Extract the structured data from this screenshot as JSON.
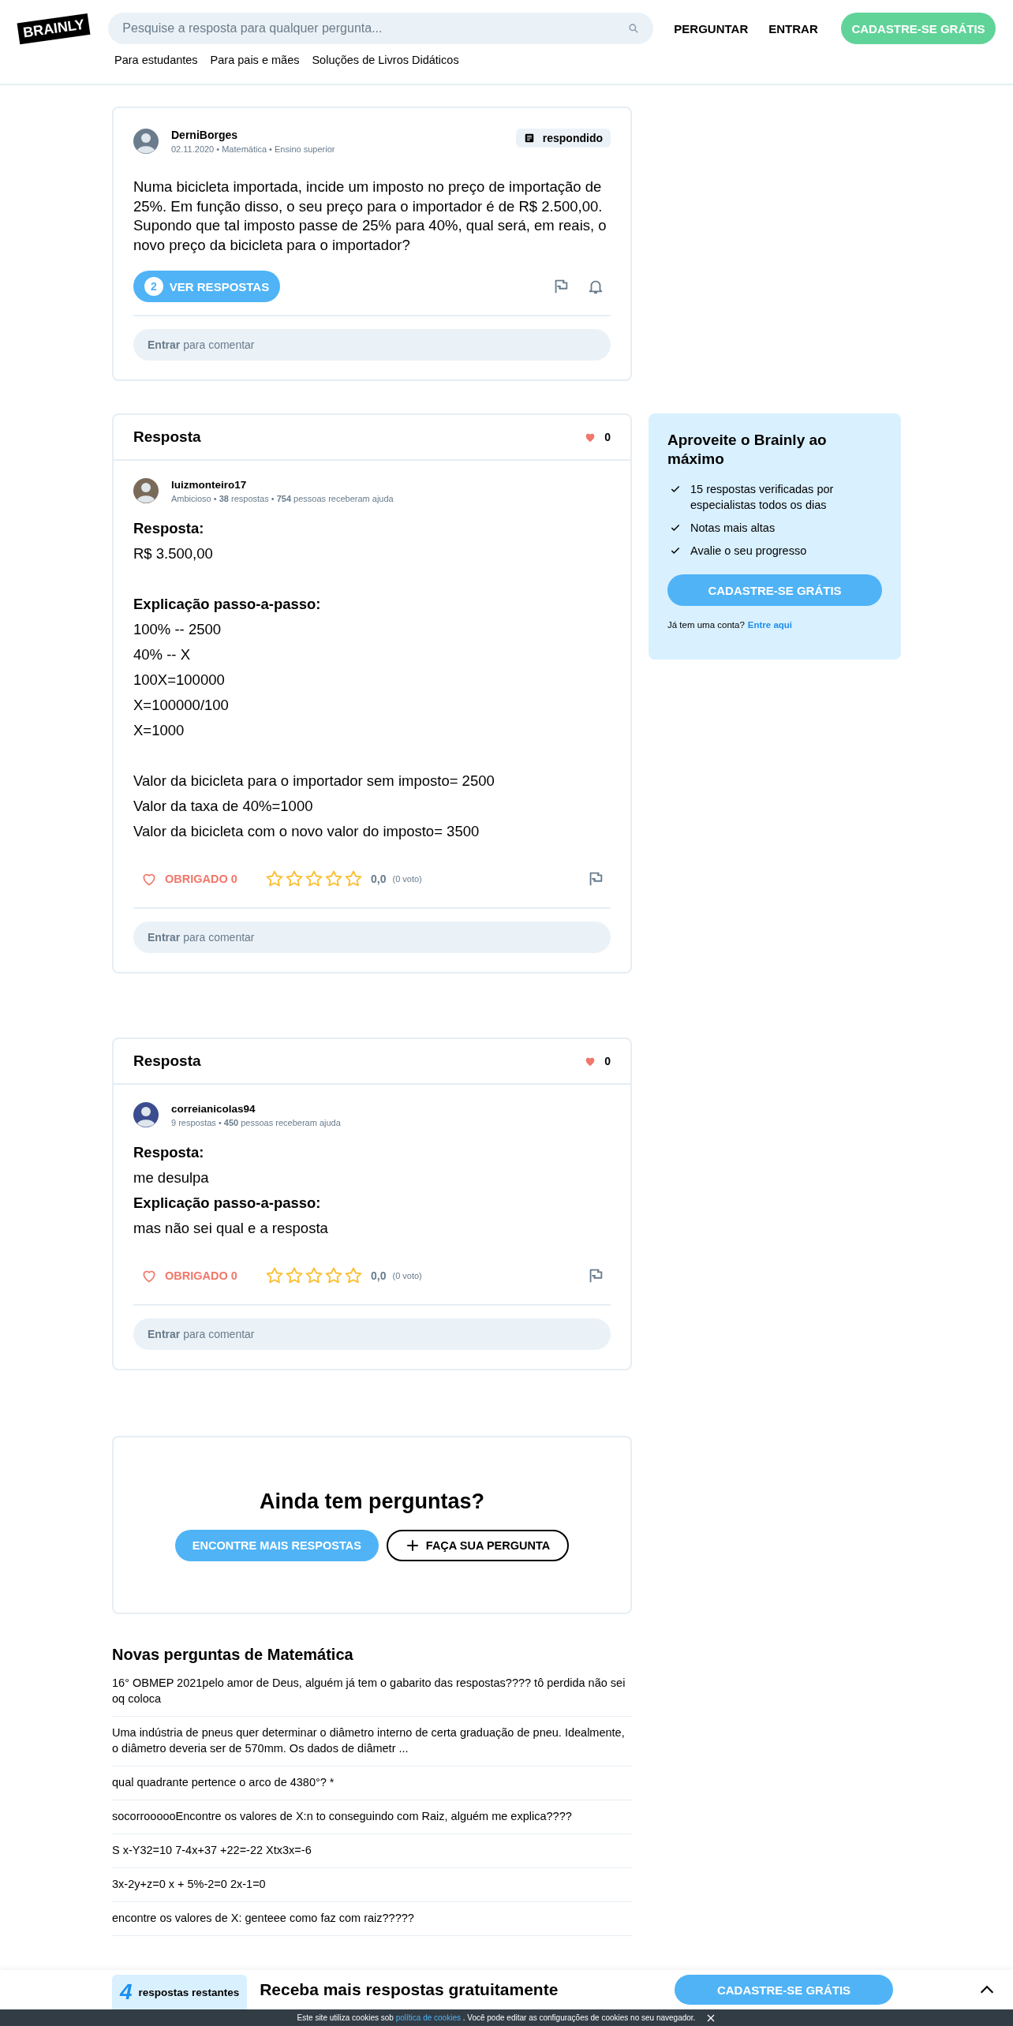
{
  "header": {
    "logo": "BRAINLY",
    "search": {
      "placeholder": "Pesquise a resposta para qualquer pergunta..."
    },
    "actions": [
      "PERGUNTAR",
      "ENTRAR"
    ],
    "signup": "CADASTRE-SE GRÁTIS",
    "nav": [
      "Para estudantes",
      "Para pais e mães",
      "Soluções de Livros Didáticos"
    ]
  },
  "question": {
    "author": "DerniBorges",
    "meta": "02.11.2020 • Matemática • Ensino superior",
    "status": "respondido",
    "text": "Numa bicicleta importada, incide um imposto no preço de importação de 25%. Em função disso, o seu preço para o importador é de R$ 2.500,00. Supondo que tal imposto passe de 25% para 40%, qual será, em reais, o novo preço da bicicleta para o importador?",
    "answers_count": "2",
    "answers_button": "VER RESPOSTAS",
    "comment": "**Entrar** para comentar"
  },
  "answers": [
    {
      "title": "Resposta",
      "likes": "0",
      "author": "luizmonteiro17",
      "stats": "Ambicioso • **38** respostas • **754** pessoas receberam ajuda",
      "body": [
        {
          "kind": "heading",
          "text": "Resposta:"
        },
        {
          "kind": "text",
          "text": "R$ 3.500,00"
        },
        {
          "kind": "spacer"
        },
        {
          "kind": "heading",
          "text": "Explicação passo-a-passo:"
        },
        {
          "kind": "text",
          "text": "100% -- 2500"
        },
        {
          "kind": "text",
          "text": "40% -- X"
        },
        {
          "kind": "text",
          "text": "100X=100000"
        },
        {
          "kind": "text",
          "text": "X=100000/100"
        },
        {
          "kind": "text",
          "text": "X=1000"
        },
        {
          "kind": "spacer"
        },
        {
          "kind": "text",
          "text": "Valor da bicicleta para o importador sem imposto= 2500"
        },
        {
          "kind": "text",
          "text": "Valor da taxa de 40%=1000"
        },
        {
          "kind": "text",
          "text": "Valor da bicicleta com o novo valor do imposto= 3500"
        }
      ],
      "thanks": "OBRIGADO 0",
      "stars": 0,
      "rating": "0,0",
      "votes": "(0 voto)",
      "comment": "**Entrar** para comentar"
    },
    {
      "title": "Resposta",
      "likes": "0",
      "author": "correianicolas94",
      "stats": "9 respostas • **450** pessoas receberam ajuda",
      "body": [
        {
          "kind": "heading",
          "text": "Resposta:"
        },
        {
          "kind": "text",
          "text": "me desulpa"
        },
        {
          "kind": "heading",
          "text": "Explicação passo-a-passo:"
        },
        {
          "kind": "text",
          "text": "mas não sei qual e a resposta"
        }
      ],
      "thanks": "OBRIGADO 0",
      "stars": 0,
      "rating": "0,0",
      "votes": "(0 voto)",
      "comment": "**Entrar** para comentar"
    }
  ],
  "ask": {
    "title": "Ainda tem perguntas?",
    "more_button": "ENCONTRE MAIS RESPOSTAS",
    "ask_button": "FAÇA SUA PERGUNTA"
  },
  "new_questions": {
    "title": "Novas perguntas de Matemática",
    "items": [
      "16° OBMEP 2021pelo amor de Deus, alguém já tem o gabarito das respostas???? tô perdida não sei oq coloca",
      "Uma indústria de pneus quer determinar o diâmetro interno de certa graduação de pneu. Idealmente, o diâmetro deveria ser de 570mm. Os dados de diâmetr ...",
      "qual quadrante pertence o arco de 4380°? *",
      "socorroooooEncontre os valores de X:n to conseguindo com Raiz, alguém me explica????",
      "S x-Y32=10 7-4x+37 +22=-22 Xtx3x=-6",
      "3x-2y+z=0 x + 5%-2=0 2x-1=0",
      "encontre os valores de X: genteee como faz com raiz?????"
    ]
  },
  "sidebar": {
    "title": "Aproveite o Brainly ao máximo",
    "benefits": [
      "15 respostas verificadas por especialistas todos os dias",
      "Notas mais altas",
      "Avalie o seu progresso"
    ],
    "button": "CADASTRE-SE GRÁTIS",
    "login_text": "Já tem uma conta?",
    "login_link": "Entre aqui"
  },
  "bottom_bar": {
    "count": "4",
    "count_label": "respostas restantes",
    "message": "Receba mais respostas gratuitamente",
    "button": "CADASTRE-SE GRÁTIS"
  },
  "cookie_bar": {
    "before": "Este site utiliza cookies sob",
    "link": "política de cookies",
    "after": ". Você pode editar as configurações de cookies no seu navegador."
  }
}
